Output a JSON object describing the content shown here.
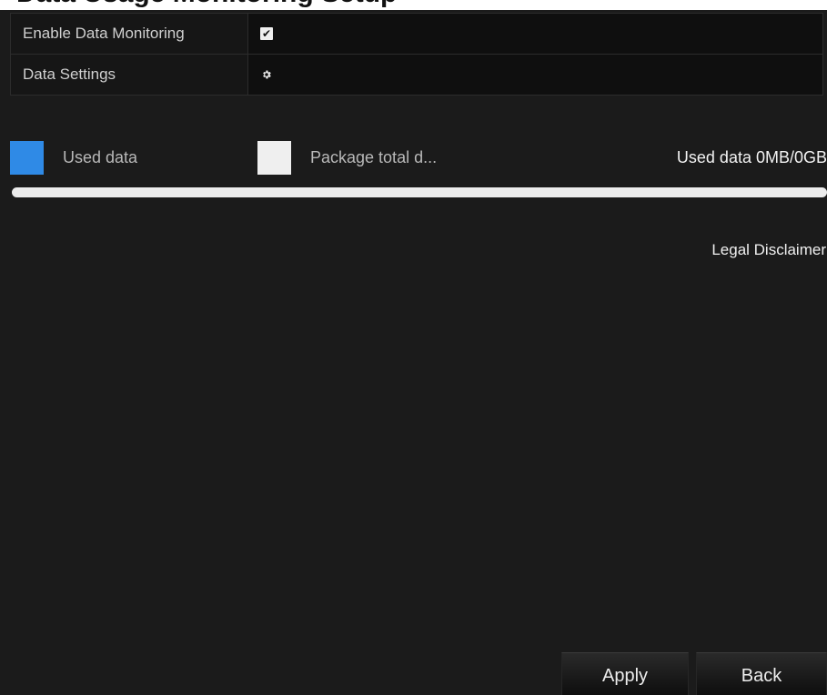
{
  "header": {
    "title": "Data Usage Monitoring Setup"
  },
  "settings": {
    "enable_label": "Enable Data Monitoring",
    "enable_checked": true,
    "enable_glyph": "✔",
    "data_settings_label": "Data Settings",
    "data_settings_icon": "gear-icon"
  },
  "legend": {
    "used_label": "Used data",
    "used_color": "#2f8ae6",
    "total_label": "Package total d...",
    "total_color": "#efefef",
    "summary": "Used data 0MB/0GB"
  },
  "usage": {
    "used_fraction": 0
  },
  "links": {
    "legal": "Legal Disclaimer"
  },
  "buttons": {
    "apply": "Apply",
    "back": "Back"
  }
}
